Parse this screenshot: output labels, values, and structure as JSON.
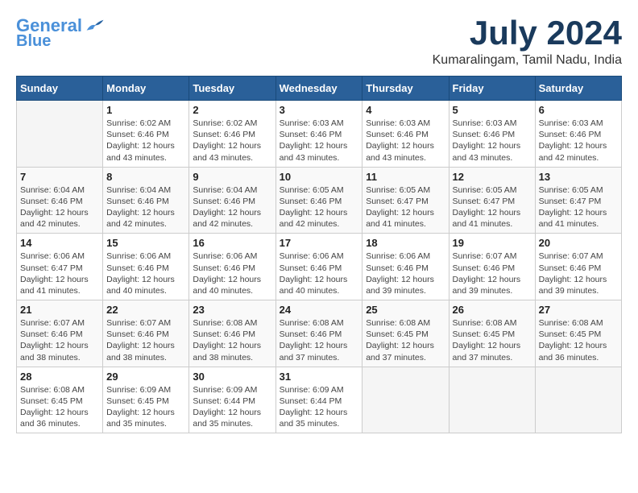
{
  "logo": {
    "general": "General",
    "blue": "Blue"
  },
  "title": "July 2024",
  "location": "Kumaralingam, Tamil Nadu, India",
  "days_of_week": [
    "Sunday",
    "Monday",
    "Tuesday",
    "Wednesday",
    "Thursday",
    "Friday",
    "Saturday"
  ],
  "weeks": [
    [
      {
        "day": "",
        "sunrise": "",
        "sunset": "",
        "daylight": ""
      },
      {
        "day": "1",
        "sunrise": "Sunrise: 6:02 AM",
        "sunset": "Sunset: 6:46 PM",
        "daylight": "Daylight: 12 hours and 43 minutes."
      },
      {
        "day": "2",
        "sunrise": "Sunrise: 6:02 AM",
        "sunset": "Sunset: 6:46 PM",
        "daylight": "Daylight: 12 hours and 43 minutes."
      },
      {
        "day": "3",
        "sunrise": "Sunrise: 6:03 AM",
        "sunset": "Sunset: 6:46 PM",
        "daylight": "Daylight: 12 hours and 43 minutes."
      },
      {
        "day": "4",
        "sunrise": "Sunrise: 6:03 AM",
        "sunset": "Sunset: 6:46 PM",
        "daylight": "Daylight: 12 hours and 43 minutes."
      },
      {
        "day": "5",
        "sunrise": "Sunrise: 6:03 AM",
        "sunset": "Sunset: 6:46 PM",
        "daylight": "Daylight: 12 hours and 43 minutes."
      },
      {
        "day": "6",
        "sunrise": "Sunrise: 6:03 AM",
        "sunset": "Sunset: 6:46 PM",
        "daylight": "Daylight: 12 hours and 42 minutes."
      }
    ],
    [
      {
        "day": "7",
        "sunrise": "Sunrise: 6:04 AM",
        "sunset": "Sunset: 6:46 PM",
        "daylight": "Daylight: 12 hours and 42 minutes."
      },
      {
        "day": "8",
        "sunrise": "Sunrise: 6:04 AM",
        "sunset": "Sunset: 6:46 PM",
        "daylight": "Daylight: 12 hours and 42 minutes."
      },
      {
        "day": "9",
        "sunrise": "Sunrise: 6:04 AM",
        "sunset": "Sunset: 6:46 PM",
        "daylight": "Daylight: 12 hours and 42 minutes."
      },
      {
        "day": "10",
        "sunrise": "Sunrise: 6:05 AM",
        "sunset": "Sunset: 6:46 PM",
        "daylight": "Daylight: 12 hours and 42 minutes."
      },
      {
        "day": "11",
        "sunrise": "Sunrise: 6:05 AM",
        "sunset": "Sunset: 6:47 PM",
        "daylight": "Daylight: 12 hours and 41 minutes."
      },
      {
        "day": "12",
        "sunrise": "Sunrise: 6:05 AM",
        "sunset": "Sunset: 6:47 PM",
        "daylight": "Daylight: 12 hours and 41 minutes."
      },
      {
        "day": "13",
        "sunrise": "Sunrise: 6:05 AM",
        "sunset": "Sunset: 6:47 PM",
        "daylight": "Daylight: 12 hours and 41 minutes."
      }
    ],
    [
      {
        "day": "14",
        "sunrise": "Sunrise: 6:06 AM",
        "sunset": "Sunset: 6:47 PM",
        "daylight": "Daylight: 12 hours and 41 minutes."
      },
      {
        "day": "15",
        "sunrise": "Sunrise: 6:06 AM",
        "sunset": "Sunset: 6:46 PM",
        "daylight": "Daylight: 12 hours and 40 minutes."
      },
      {
        "day": "16",
        "sunrise": "Sunrise: 6:06 AM",
        "sunset": "Sunset: 6:46 PM",
        "daylight": "Daylight: 12 hours and 40 minutes."
      },
      {
        "day": "17",
        "sunrise": "Sunrise: 6:06 AM",
        "sunset": "Sunset: 6:46 PM",
        "daylight": "Daylight: 12 hours and 40 minutes."
      },
      {
        "day": "18",
        "sunrise": "Sunrise: 6:06 AM",
        "sunset": "Sunset: 6:46 PM",
        "daylight": "Daylight: 12 hours and 39 minutes."
      },
      {
        "day": "19",
        "sunrise": "Sunrise: 6:07 AM",
        "sunset": "Sunset: 6:46 PM",
        "daylight": "Daylight: 12 hours and 39 minutes."
      },
      {
        "day": "20",
        "sunrise": "Sunrise: 6:07 AM",
        "sunset": "Sunset: 6:46 PM",
        "daylight": "Daylight: 12 hours and 39 minutes."
      }
    ],
    [
      {
        "day": "21",
        "sunrise": "Sunrise: 6:07 AM",
        "sunset": "Sunset: 6:46 PM",
        "daylight": "Daylight: 12 hours and 38 minutes."
      },
      {
        "day": "22",
        "sunrise": "Sunrise: 6:07 AM",
        "sunset": "Sunset: 6:46 PM",
        "daylight": "Daylight: 12 hours and 38 minutes."
      },
      {
        "day": "23",
        "sunrise": "Sunrise: 6:08 AM",
        "sunset": "Sunset: 6:46 PM",
        "daylight": "Daylight: 12 hours and 38 minutes."
      },
      {
        "day": "24",
        "sunrise": "Sunrise: 6:08 AM",
        "sunset": "Sunset: 6:46 PM",
        "daylight": "Daylight: 12 hours and 37 minutes."
      },
      {
        "day": "25",
        "sunrise": "Sunrise: 6:08 AM",
        "sunset": "Sunset: 6:45 PM",
        "daylight": "Daylight: 12 hours and 37 minutes."
      },
      {
        "day": "26",
        "sunrise": "Sunrise: 6:08 AM",
        "sunset": "Sunset: 6:45 PM",
        "daylight": "Daylight: 12 hours and 37 minutes."
      },
      {
        "day": "27",
        "sunrise": "Sunrise: 6:08 AM",
        "sunset": "Sunset: 6:45 PM",
        "daylight": "Daylight: 12 hours and 36 minutes."
      }
    ],
    [
      {
        "day": "28",
        "sunrise": "Sunrise: 6:08 AM",
        "sunset": "Sunset: 6:45 PM",
        "daylight": "Daylight: 12 hours and 36 minutes."
      },
      {
        "day": "29",
        "sunrise": "Sunrise: 6:09 AM",
        "sunset": "Sunset: 6:45 PM",
        "daylight": "Daylight: 12 hours and 35 minutes."
      },
      {
        "day": "30",
        "sunrise": "Sunrise: 6:09 AM",
        "sunset": "Sunset: 6:44 PM",
        "daylight": "Daylight: 12 hours and 35 minutes."
      },
      {
        "day": "31",
        "sunrise": "Sunrise: 6:09 AM",
        "sunset": "Sunset: 6:44 PM",
        "daylight": "Daylight: 12 hours and 35 minutes."
      },
      {
        "day": "",
        "sunrise": "",
        "sunset": "",
        "daylight": ""
      },
      {
        "day": "",
        "sunrise": "",
        "sunset": "",
        "daylight": ""
      },
      {
        "day": "",
        "sunrise": "",
        "sunset": "",
        "daylight": ""
      }
    ]
  ]
}
